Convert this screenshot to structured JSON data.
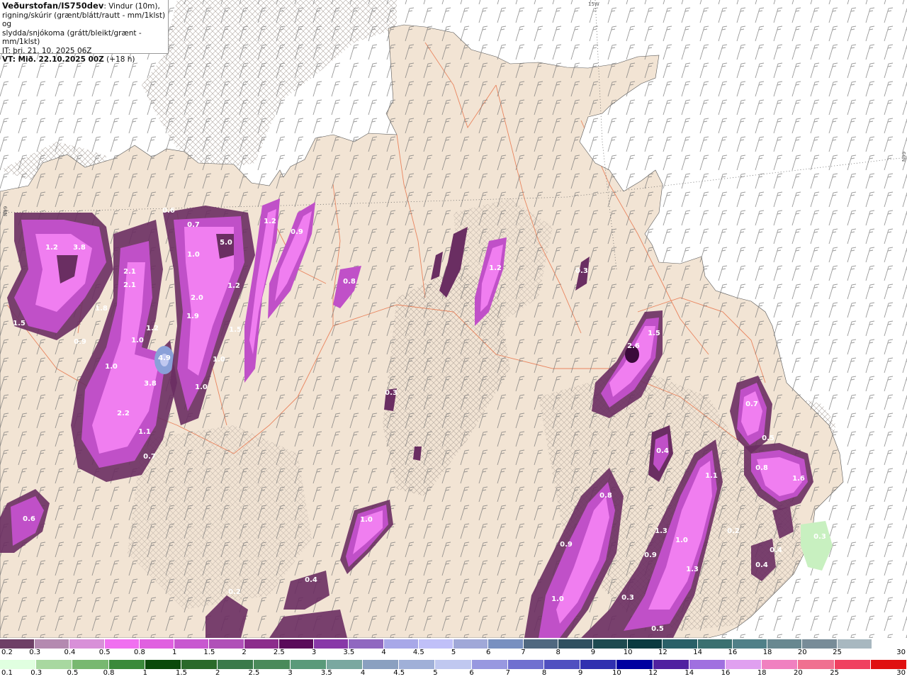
{
  "header": {
    "brand": "Veðurstofan/IS750dev",
    "line1_rest": ": Vindur (10m),",
    "line2": "rigning/skúrir (grænt/blátt/rautt - mm/1klst) og",
    "line3": "slydda/snjókoma (grátt/bleikt/grænt - mm/1klst)",
    "it": "IT: þri. 21. 10. 2025 06Z",
    "vt": "VT: Mið. 22.10.2025 00Z",
    "lead": "(+18 h)"
  },
  "grid_labels": {
    "top": "15W",
    "left": "N99",
    "right": "N99"
  },
  "precip_labels": [
    "1.2",
    "3.8",
    "2.1",
    "2.1",
    "1.8",
    "1.5",
    "0.9",
    "1.2",
    "1.0",
    "1.0",
    "4.9",
    "3.8",
    "2.2",
    "1.1",
    "0.7",
    "0.6",
    "0.7",
    "1.0",
    "5.0",
    "2.0",
    "1.9",
    "1.2",
    "1.5",
    "1.0",
    "1.0",
    "1.2",
    "0.9",
    "0.8",
    "1.2",
    "0.3",
    "0.3",
    "1.0",
    "0.6",
    "2.6",
    "1.5",
    "0.4",
    "0.7",
    "0.5",
    "0.8",
    "1.6",
    "1.1",
    "0.8",
    "0.9",
    "1.0",
    "0.3",
    "1.3",
    "1.0",
    "0.9",
    "1.3",
    "0.4",
    "0.4",
    "0.4",
    "0.2",
    "0.5",
    "0.2",
    "0.3"
  ],
  "colors": {
    "sea": "#ffffff",
    "land": "#f2e4d4",
    "hatch": "#9a8f88",
    "roads": "#e8744a",
    "snow_light": "#f07ef0",
    "snow_mid": "#c050c8",
    "snow_dark": "#6a2e62",
    "rain_light": "#c8f0c0"
  },
  "legend_snow": {
    "labels": [
      "0.2",
      "0.3",
      "0.4",
      "0.5",
      "0.8",
      "1",
      "1.5",
      "2",
      "2.5",
      "3",
      "3.5",
      "4",
      "4.5",
      "5",
      "6",
      "7",
      "8",
      "9",
      "10",
      "12",
      "14",
      "16",
      "18",
      "20",
      "25",
      "30"
    ],
    "colors": [
      "#6e3f66",
      "#b48ab0",
      "#d890d8",
      "#f070f0",
      "#e060e0",
      "#c858d0",
      "#b050b8",
      "#8c2c8c",
      "#5a0a5a",
      "#8838a8",
      "#9068c0",
      "#a8a8e8",
      "#c0c0f8",
      "#a0a8d8",
      "#7890c0",
      "#506880",
      "#305060",
      "#1e4a50",
      "#0a3a40",
      "#2a6068",
      "#3a7070",
      "#508088",
      "#688890",
      "#788c98",
      "#a8b8c0",
      "#ffffff"
    ]
  },
  "legend_rain": {
    "labels": [
      "0.1",
      "0.3",
      "0.5",
      "0.8",
      "1",
      "1.5",
      "2",
      "2.5",
      "3",
      "3.5",
      "4",
      "4.5",
      "5",
      "6",
      "7",
      "8",
      "9",
      "10",
      "12",
      "14",
      "16",
      "18",
      "20",
      "25",
      "30"
    ],
    "colors": [
      "#e0ffe0",
      "#a8d8a0",
      "#78b870",
      "#3a8a3a",
      "#0a4a0a",
      "#2a6a2a",
      "#3a7a4a",
      "#4a8a5a",
      "#5a9a7a",
      "#7aa8a0",
      "#8aa0c0",
      "#a0b0d8",
      "#c0c8f0",
      "#9898e0",
      "#7070d0",
      "#5050c0",
      "#3030b0",
      "#0000a0",
      "#5020a0",
      "#a070e0",
      "#e0a0f0",
      "#f080c0",
      "#f07090",
      "#f04060",
      "#e01010"
    ]
  }
}
